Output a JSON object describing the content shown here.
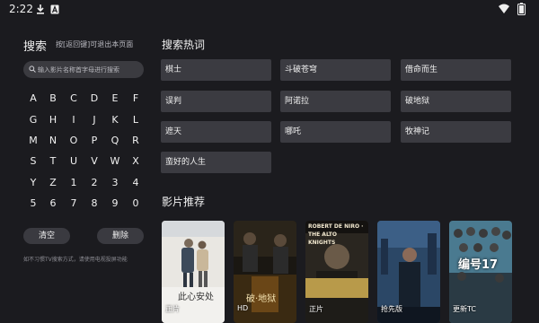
{
  "status_bar": {
    "time": "2:22",
    "icons": [
      "download-icon",
      "notification-a-icon",
      "wifi-icon",
      "battery-icon"
    ]
  },
  "search": {
    "title": "搜索",
    "hint": "按[返回键]可退出本页面",
    "placeholder": "输入影片名称首字母进行搜索",
    "value": ""
  },
  "keyboard": {
    "rows": [
      [
        "A",
        "B",
        "C",
        "D",
        "E",
        "F"
      ],
      [
        "G",
        "H",
        "I",
        "J",
        "K",
        "L"
      ],
      [
        "M",
        "N",
        "O",
        "P",
        "Q",
        "R"
      ],
      [
        "S",
        "T",
        "U",
        "V",
        "W",
        "X"
      ],
      [
        "Y",
        "Z",
        "1",
        "2",
        "3",
        "4"
      ],
      [
        "5",
        "6",
        "7",
        "8",
        "9",
        "0"
      ]
    ]
  },
  "actions": {
    "clear": "清空",
    "delete": "删除"
  },
  "note": "如不习惯TV搜索方式，请使用电视投屏功能",
  "hot": {
    "title": "搜索热词",
    "items": [
      "棋士",
      "斗破苍穹",
      "借命而生",
      "误判",
      "阿诺拉",
      "破地狱",
      "遮天",
      "哪吒",
      "牧神记",
      "蛮好的人生"
    ]
  },
  "recommend": {
    "title": "影片推荐",
    "items": [
      {
        "tag": "正片",
        "caption": "此心安处"
      },
      {
        "tag": "HD",
        "caption": "破·地狱"
      },
      {
        "tag": "正片",
        "caption": "ROBERT DE NIRO · THE ALTO KNIGHTS"
      },
      {
        "tag": "抢先版",
        "caption": ""
      },
      {
        "tag": "更新TC",
        "caption": "编号17"
      }
    ]
  },
  "colors": {
    "background": "#1b1b1f",
    "tile": "#3b3b41",
    "text": "#f0f0f0"
  }
}
